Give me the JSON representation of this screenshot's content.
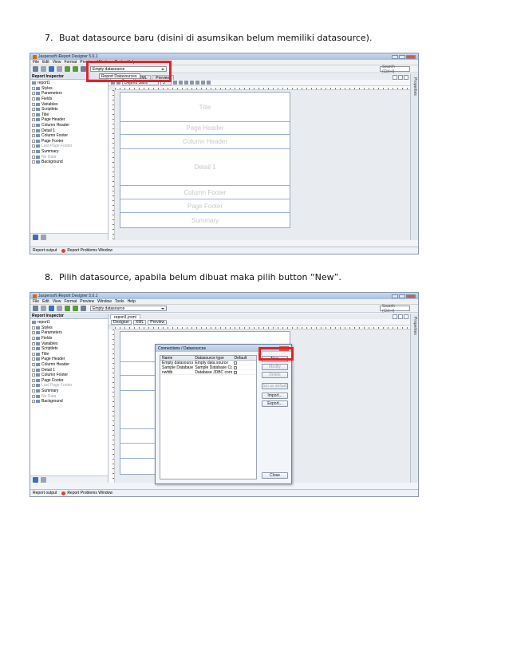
{
  "step7": {
    "number": "7.",
    "text": "Buat datasource baru (disini di asumsikan belum memiliki datasource)."
  },
  "step8": {
    "number": "8.",
    "text": "Pilih datasource, apabila belum dibuat maka pilih button “New”."
  },
  "app": {
    "title": "Jaspersoft iReport Designer 5.0.1",
    "menu": [
      "File",
      "Edit",
      "View",
      "Format",
      "Preview",
      "Window",
      "Tools",
      "Help"
    ],
    "datasource_selected": "Empty datasource",
    "datasource_option": "Report Datasources",
    "search_placeholder": "Search (Ctrl+I)",
    "panel_title": "Report Inspector",
    "tree": [
      {
        "label": "report1",
        "root": true,
        "dim": false
      },
      {
        "label": "Styles",
        "dim": false
      },
      {
        "label": "Parameters",
        "dim": false
      },
      {
        "label": "Fields",
        "dim": false
      },
      {
        "label": "Variables",
        "dim": false
      },
      {
        "label": "Scriptlets",
        "dim": false
      },
      {
        "label": "Title",
        "dim": false
      },
      {
        "label": "Page Header",
        "dim": false
      },
      {
        "label": "Column Header",
        "dim": false
      },
      {
        "label": "Detail 1",
        "dim": false
      },
      {
        "label": "Column Footer",
        "dim": false
      },
      {
        "label": "Page Footer",
        "dim": false
      },
      {
        "label": "Last Page Footer",
        "dim": true
      },
      {
        "label": "Summary",
        "dim": false
      },
      {
        "label": "No Data",
        "dim": true
      },
      {
        "label": "Background",
        "dim": false
      }
    ],
    "tabs": {
      "designer": "Designer",
      "xml": "XML",
      "preview": "Preview",
      "file_tab": "report1.jrxml"
    },
    "font_name": "DejaVu Sans",
    "font_size": "3",
    "bands": [
      "Title",
      "Page Header",
      "Column Header",
      "Detail 1",
      "Column Footer",
      "Page Footer",
      "Summary"
    ],
    "properties_label": "Properties",
    "status": {
      "output": "Report output",
      "problems": "Report Problems Window"
    }
  },
  "dialog": {
    "title": "Connections / Datasources",
    "columns": [
      "Name",
      "Datasource type",
      "Default"
    ],
    "rows": [
      {
        "name": "Empty datasource",
        "type": "Empty data source"
      },
      {
        "name": "Sample Database (HS...",
        "type": "Sample Database Co..."
      },
      {
        "name": "nwfdb",
        "type": "Database JDBC conn..."
      }
    ],
    "buttons": {
      "new": "New",
      "modify": "Modify",
      "delete": "Delete",
      "set_default": "Set as default",
      "import": "Import...",
      "export": "Export...",
      "close": "Close"
    }
  }
}
